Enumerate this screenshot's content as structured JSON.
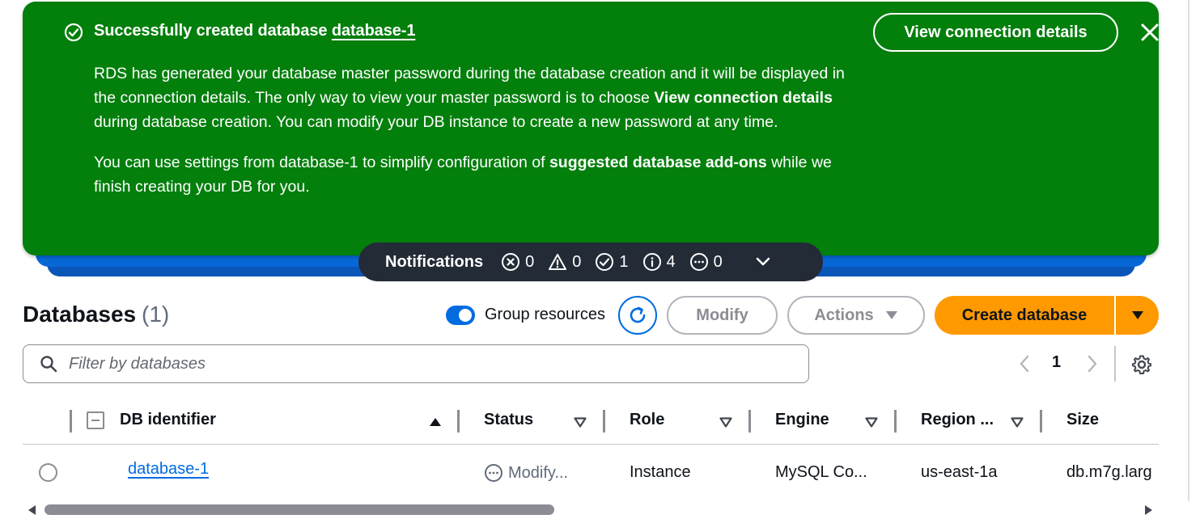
{
  "flash": {
    "title_prefix": "Successfully created database",
    "title_db": "database-1",
    "para1_a": "RDS has generated your database master password during the database creation and it will be displayed in the connection details. The only way to view your master password is to choose ",
    "para1_b": "View connection details",
    "para1_c": " during database creation. You can modify your DB instance to create a new password at any time.",
    "para2_a": "You can use settings from database-1 to simplify configuration of ",
    "para2_b": "suggested database add-ons",
    "para2_c": " while we finish creating your DB for you.",
    "view_button": "View connection details",
    "color": "#037f0c"
  },
  "notifications": {
    "label": "Notifications",
    "error_count": "0",
    "warning_count": "0",
    "success_count": "1",
    "info_count": "4",
    "in_progress_count": "0"
  },
  "header": {
    "title": "Databases",
    "count": "(1)",
    "group_resources_label": "Group resources",
    "group_resources_on": true,
    "modify_label": "Modify",
    "actions_label": "Actions",
    "create_label": "Create database",
    "accent": "#ff9900"
  },
  "filter": {
    "placeholder": "Filter by databases"
  },
  "pagination": {
    "current_page": "1"
  },
  "table": {
    "columns": [
      "DB identifier",
      "Status",
      "Role",
      "Engine",
      "Region ...",
      "Size"
    ],
    "rows": [
      {
        "identifier": "database-1",
        "status": "Modify...",
        "role": "Instance",
        "engine": "MySQL Co...",
        "region": "us-east-1a",
        "size": "db.m7g.larg"
      }
    ]
  }
}
